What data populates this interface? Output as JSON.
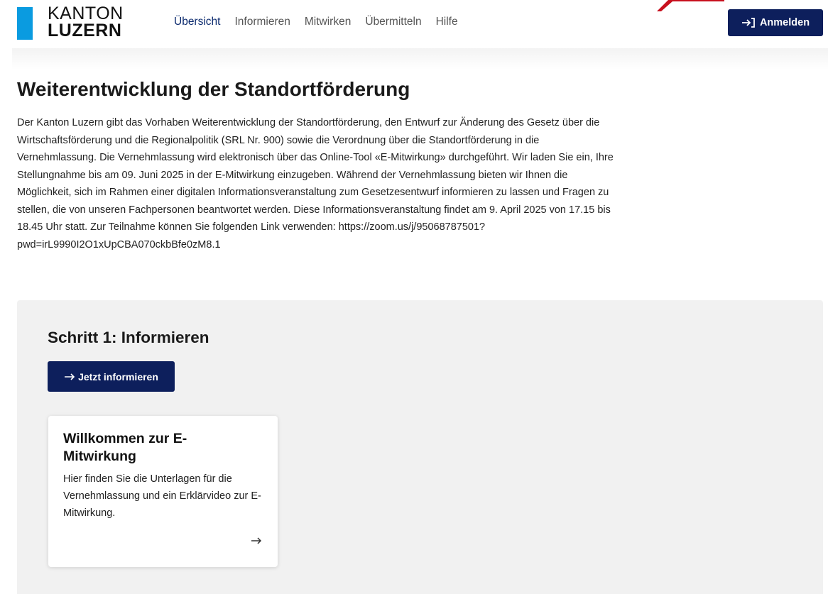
{
  "header": {
    "logo_line1": "KANTON",
    "logo_line2": "LUZERN",
    "nav": [
      {
        "label": "Übersicht",
        "active": true
      },
      {
        "label": "Informieren"
      },
      {
        "label": "Mitwirken"
      },
      {
        "label": "Übermitteln"
      },
      {
        "label": "Hilfe"
      }
    ],
    "login_label": "Anmelden"
  },
  "main": {
    "title": "Weiterentwicklung der Standortförderung",
    "description": "Der Kanton Luzern gibt das Vorhaben Weiterentwicklung der Standortförderung, den Entwurf zur Änderung des Gesetz über die Wirtschaftsförderung und die Regionalpolitik (SRL Nr. 900) sowie die Verordnung über die Standortförderung in die Vernehmlassung. Die Vernehmlassung wird elektronisch über das Online-Tool «E-Mitwirkung» durchgeführt. Wir laden Sie ein, Ihre Stellungnahme bis am 09. Juni 2025 in der E-Mitwirkung einzugeben. Während der Vernehmlassung bieten wir Ihnen die Möglichkeit, sich im Rahmen einer digitalen Informationsveranstaltung zum Gesetzesentwurf informieren zu lassen und Fragen zu stellen, die von unseren Fachpersonen beantwortet werden. Diese Informationsveranstaltung findet am 9. April 2025 von 17.15 bis 18.45 Uhr statt. Zur Teilnahme können Sie folgenden Link verwenden: https://zoom.us/j/95068787501?pwd=irL9990I2O1xUpCBA070ckbBfe0zM8.1"
  },
  "step": {
    "title": "Schritt 1: Informieren",
    "button_label": "Jetzt informieren",
    "card": {
      "title": "Willkommen zur E-Mitwirkung",
      "text": "Hier finden Sie die Unterlagen für die Vernehmlassung und ein Erklärvideo zur E-Mitwirkung."
    }
  },
  "colors": {
    "brand_blue": "#0a9be0",
    "primary_navy": "#0d1f5c",
    "annotation_red": "#c8101e"
  },
  "icons": {
    "login": "login-arrow-icon",
    "button_arrow": "arrow-right-icon",
    "card_arrow": "arrow-right-icon"
  }
}
